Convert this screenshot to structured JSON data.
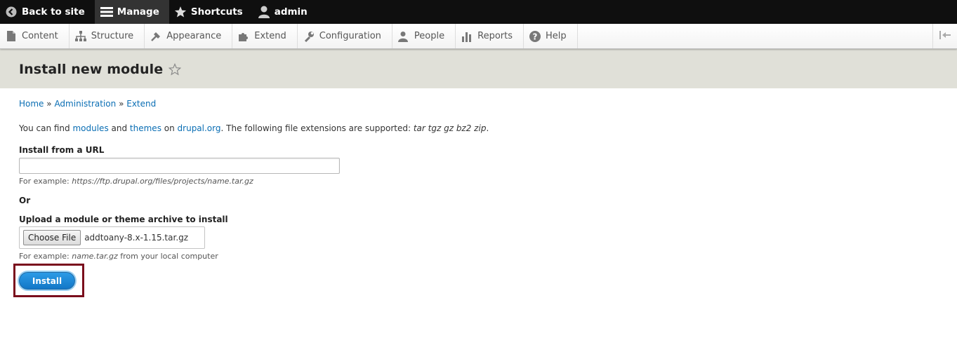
{
  "toolbar": {
    "back_to_site": "Back to site",
    "manage": "Manage",
    "shortcuts": "Shortcuts",
    "user": "admin"
  },
  "tray": {
    "items": [
      {
        "label": "Content",
        "icon": "content-icon"
      },
      {
        "label": "Structure",
        "icon": "structure-icon"
      },
      {
        "label": "Appearance",
        "icon": "appearance-icon"
      },
      {
        "label": "Extend",
        "icon": "extend-icon"
      },
      {
        "label": "Configuration",
        "icon": "configuration-icon"
      },
      {
        "label": "People",
        "icon": "people-icon"
      },
      {
        "label": "Reports",
        "icon": "reports-icon"
      },
      {
        "label": "Help",
        "icon": "help-icon"
      }
    ]
  },
  "page": {
    "title": "Install new module"
  },
  "breadcrumb": {
    "home": "Home",
    "sep": "»",
    "administration": "Administration",
    "extend": "Extend"
  },
  "intro": {
    "part1": "You can find ",
    "modules": "modules",
    "and": " and ",
    "themes": "themes",
    "on": " on ",
    "drupal": "drupal.org",
    "part2": ". The following file extensions are supported: ",
    "extensions": "tar tgz gz bz2 zip",
    "end": "."
  },
  "form": {
    "url_label": "Install from a URL",
    "url_value": "",
    "url_desc_prefix": "For example: ",
    "url_desc_example": "https://ftp.drupal.org/files/projects/name.tar.gz",
    "or": "Or",
    "upload_label": "Upload a module or theme archive to install",
    "choose_file": "Choose File",
    "file_name": "addtoany-8.x-1.15.tar.gz",
    "upload_desc_prefix": "For example: ",
    "upload_desc_example": "name.tar.gz",
    "upload_desc_suffix": " from your local computer",
    "install": "Install"
  },
  "colors": {
    "toolbar_bg": "#0f0f0f",
    "link": "#0a6eb4",
    "install_button": "#1a84d2",
    "highlight_border": "#7a0c1c"
  }
}
